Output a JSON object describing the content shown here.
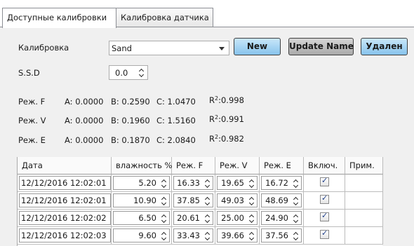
{
  "tabs": [
    {
      "label": "Доступные калибровки",
      "active": true
    },
    {
      "label": "Калибровка датчика",
      "active": false
    }
  ],
  "calibration": {
    "label": "Калибровка",
    "selected": "Sand",
    "buttons": {
      "new": "New",
      "update": "Update Name",
      "delete": "Удален"
    }
  },
  "ssd": {
    "label": "S.S.D",
    "value": "0.0"
  },
  "modes": [
    {
      "name": "Реж. F",
      "a": "A: 0.0000",
      "b": "B: 0.2590",
      "c": "C: 1.0470",
      "r2": ":0.998"
    },
    {
      "name": "Реж. V",
      "a": "A: 0.0000",
      "b": "B: 0.1960",
      "c": "C: 1.5160",
      "r2": ":0.991"
    },
    {
      "name": "Реж. E",
      "a": "A: 0.0000",
      "b": "B: 0.1870",
      "c": "C: 2.0840",
      "r2": ":0.982"
    }
  ],
  "r2_prefix": "R",
  "r2_sup": "2",
  "table": {
    "columns": [
      "Дата",
      "влажность %",
      "Реж. F",
      "Реж. V",
      "Реж. E",
      "Включ.",
      "Прим."
    ],
    "rows": [
      {
        "date": "12/12/2016 12:02:01",
        "moisture": "5.20",
        "f": "16.33",
        "v": "19.65",
        "e": "16.72",
        "enabled": true,
        "note": ""
      },
      {
        "date": "12/12/2016 12:02:01",
        "moisture": "10.90",
        "f": "37.85",
        "v": "49.03",
        "e": "48.69",
        "enabled": true,
        "note": ""
      },
      {
        "date": "12/12/2016 12:02:02",
        "moisture": "6.50",
        "f": "20.61",
        "v": "25.00",
        "e": "24.90",
        "enabled": true,
        "note": ""
      },
      {
        "date": "12/12/2016 12:02:03",
        "moisture": "9.60",
        "f": "33.43",
        "v": "39.66",
        "e": "37.56",
        "enabled": true,
        "note": ""
      }
    ]
  },
  "colors": {
    "accent_button": "#9fd0f2",
    "neutral_button": "#bdbdbd",
    "panel_bg": "#f0f0f0"
  }
}
